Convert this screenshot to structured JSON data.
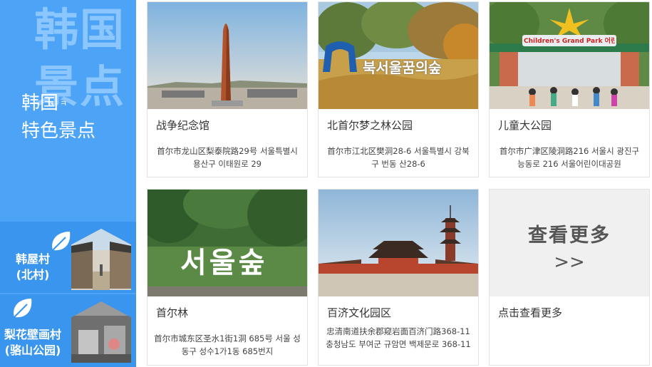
{
  "sidebar": {
    "big_title": "韩国景点",
    "subtitle_line1": "韩国",
    "subtitle_mark": "ㅋ",
    "subtitle_line2": "特色景点",
    "cards": [
      {
        "label": "韩屋村\n(北村)",
        "icon": "leaf-icon"
      },
      {
        "label": "梨花壁画村\n(骆山公园)",
        "icon": "leaf-icon"
      }
    ]
  },
  "attractions": [
    {
      "name": "战争纪念馆",
      "address": "首尔市龙山区梨泰院路29号 서울특별시 용산구 이태원로 29"
    },
    {
      "name": "北首尔梦之林公园",
      "address": "首尔市江北区樊洞28-6 서울특별시 강북구 번동 산28-6",
      "sign_text": "북서울꿈의숲"
    },
    {
      "name": "儿童大公园",
      "address": "首尔市广津区陵洞路216 서울시 광진구 능동로 216 서울어린이대공원",
      "sign_text": "Children's Grand Park 어린이대공원"
    },
    {
      "name": "首尔林",
      "address": "首尔市城东区圣水1街1洞 685号 서울 성동구 성수1가1동 685번지",
      "sign_text": "서울숲"
    },
    {
      "name": "百济文化园区",
      "address": "忠清南道扶余郡窥岩面百济门路368-11 충청남도 부여군 규암면 백제문로 368-11"
    }
  ],
  "more": {
    "title": "查看更多",
    "arrows": ">>",
    "link": "点击查看更多"
  }
}
